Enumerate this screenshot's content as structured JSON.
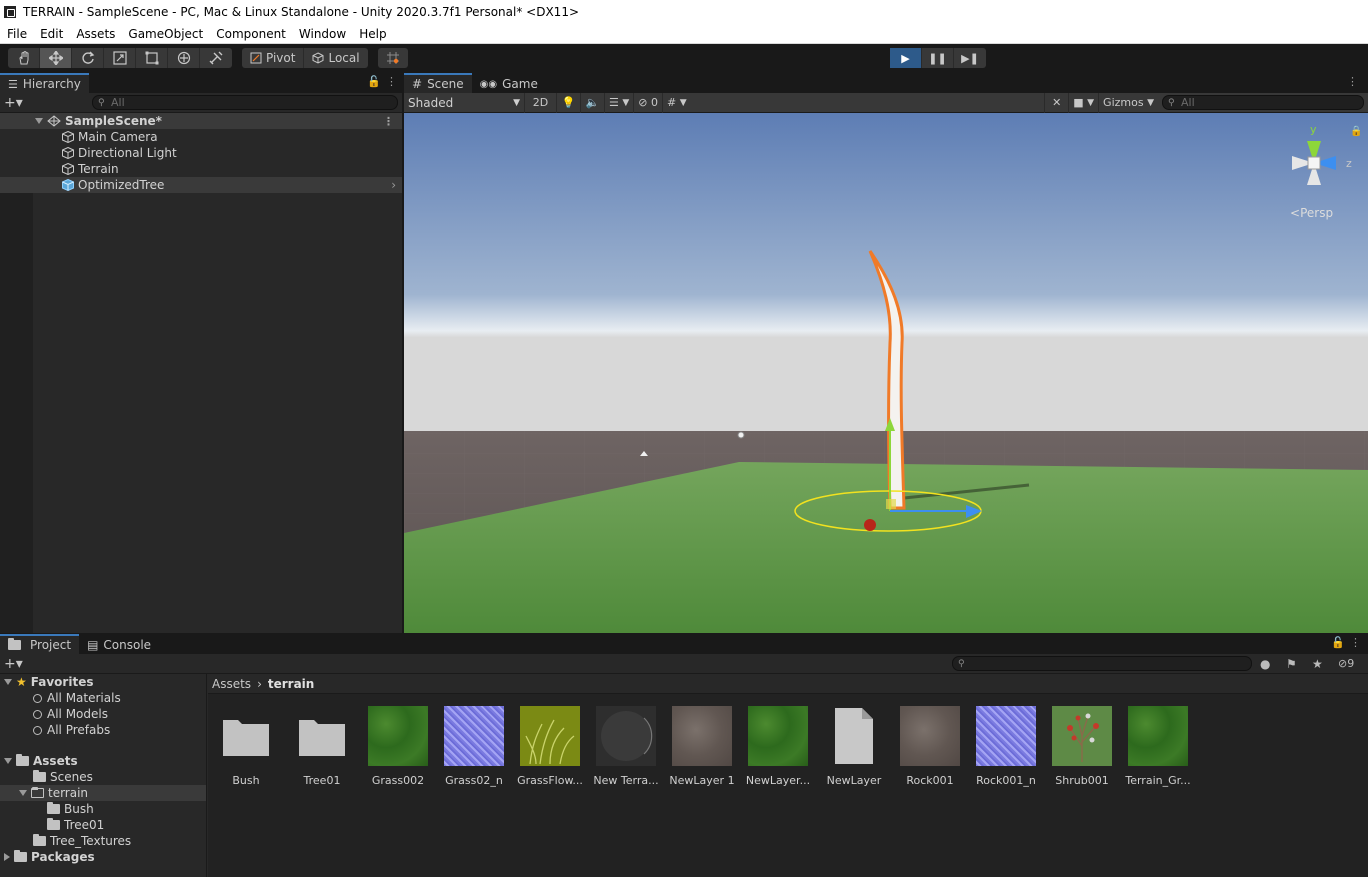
{
  "window": {
    "title": "TERRAIN - SampleScene - PC, Mac & Linux Standalone - Unity 2020.3.7f1 Personal* <DX11>"
  },
  "menu": [
    "File",
    "Edit",
    "Assets",
    "GameObject",
    "Component",
    "Window",
    "Help"
  ],
  "toolbar": {
    "pivot_label": "Pivot",
    "local_label": "Local"
  },
  "hierarchy": {
    "tab": "Hierarchy",
    "search_placeholder": "All",
    "scene_name": "SampleScene*",
    "items": [
      {
        "label": "Main Camera",
        "prefab": false
      },
      {
        "label": "Directional Light",
        "prefab": false
      },
      {
        "label": "Terrain",
        "prefab": false
      },
      {
        "label": "OptimizedTree",
        "prefab": true
      }
    ]
  },
  "scene_view": {
    "tabs": [
      "Scene",
      "Game"
    ],
    "shading_mode": "Shaded",
    "mode_2d": "2D",
    "hidden_count": "0",
    "gizmos_label": "Gizmos",
    "search_placeholder": "All",
    "projection": "Persp",
    "axes": {
      "y": "y",
      "z": "z"
    }
  },
  "project": {
    "tabs": [
      "Project",
      "Console"
    ],
    "hidden_count": "9",
    "favorites_label": "Favorites",
    "favorites": [
      "All Materials",
      "All Models",
      "All Prefabs"
    ],
    "assets_label": "Assets",
    "tree": [
      {
        "label": "Scenes",
        "level": 1
      },
      {
        "label": "terrain",
        "level": 1,
        "open": true,
        "selected": true
      },
      {
        "label": "Bush",
        "level": 2
      },
      {
        "label": "Tree01",
        "level": 2
      },
      {
        "label": "Tree_Textures",
        "level": 1
      }
    ],
    "packages_label": "Packages",
    "breadcrumb": [
      "Assets",
      "terrain"
    ],
    "assets": [
      {
        "label": "Bush",
        "kind": "folder"
      },
      {
        "label": "Tree01",
        "kind": "folder"
      },
      {
        "label": "Grass002",
        "kind": "grass"
      },
      {
        "label": "Grass02_n",
        "kind": "normal"
      },
      {
        "label": "GrassFlow...",
        "kind": "grassflower"
      },
      {
        "label": "New Terra...",
        "kind": "terrainlayer"
      },
      {
        "label": "NewLayer 1",
        "kind": "rock"
      },
      {
        "label": "NewLayer...",
        "kind": "grass"
      },
      {
        "label": "NewLayer",
        "kind": "file"
      },
      {
        "label": "Rock001",
        "kind": "rock"
      },
      {
        "label": "Rock001_n",
        "kind": "normal"
      },
      {
        "label": "Shrub001",
        "kind": "shrub"
      },
      {
        "label": "Terrain_Gr...",
        "kind": "grass"
      }
    ]
  },
  "colors": {
    "accent": "#3a79bb",
    "play_active": "#2d5a8a",
    "selection_outline": "#f07a28",
    "ground": "#5c9a45",
    "sky": "#6b8bbd"
  }
}
